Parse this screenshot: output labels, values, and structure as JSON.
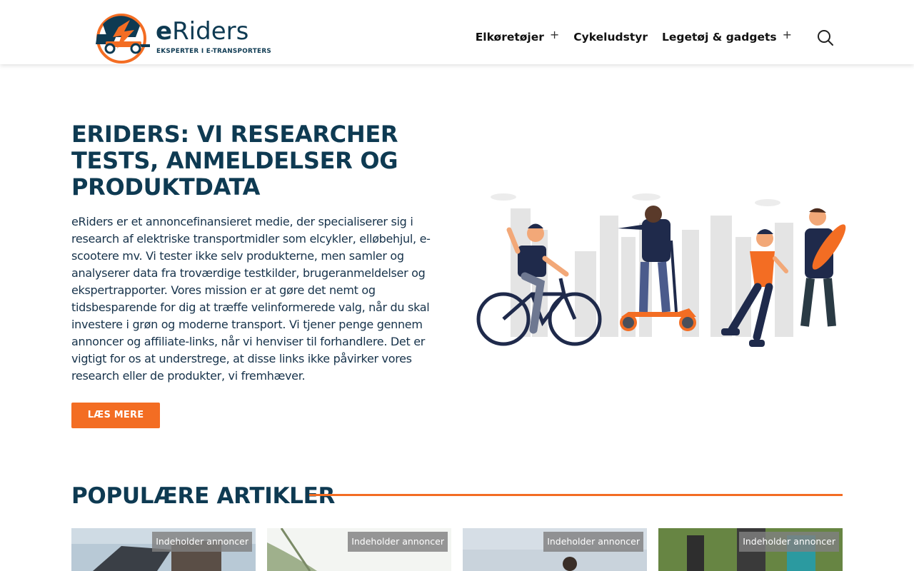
{
  "header": {
    "logo": {
      "name_bold": "e",
      "name_rest": "Riders",
      "tagline": "EKSPERTER I E-TRANSPORTERS"
    },
    "nav": [
      {
        "label": "Elkøretøjer",
        "has_submenu": true,
        "submenu_icon": "plus-icon"
      },
      {
        "label": "Cykeludstyr",
        "has_submenu": false
      },
      {
        "label": "Legetøj & gadgets",
        "has_submenu": true,
        "submenu_icon": "plus-icon"
      }
    ],
    "search_icon": "search-icon"
  },
  "hero": {
    "title": "ERIDERS: VI RESEARCHER TESTS, ANMELDELSER OG PRODUKTDATA",
    "text": "eRiders er et annoncefinansieret medie, der specialiserer sig i research af elektriske transportmidler som elcykler, elløbehjul, e-scootere mv. Vi tester ikke selv produkterne, men samler og analyserer data fra troværdige testkilder, brugeranmeldelser og ekspertrapporter. Vores mission er at gøre det nemt og tidsbesparende for dig at træffe velinformerede valg, når du skal investere i grøn og moderne transport. Vi tjener penge gennem annoncer og affiliate-links, når vi henviser til forhandlere. Det er vigtigt for os at understrege, at disse links ikke påvirker vores research eller de produkter, vi fremhæver.",
    "cta_label": "LÆS MERE"
  },
  "popular": {
    "title": "POPULÆRE ARTIKLER",
    "cards": [
      {
        "badge": "Indeholder annoncer"
      },
      {
        "badge": "Indeholder annoncer"
      },
      {
        "badge": "Indeholder annoncer"
      },
      {
        "badge": "Indeholder annoncer"
      }
    ]
  },
  "colors": {
    "brand_navy": "#0e3a52",
    "accent_orange": "#f36d23"
  }
}
